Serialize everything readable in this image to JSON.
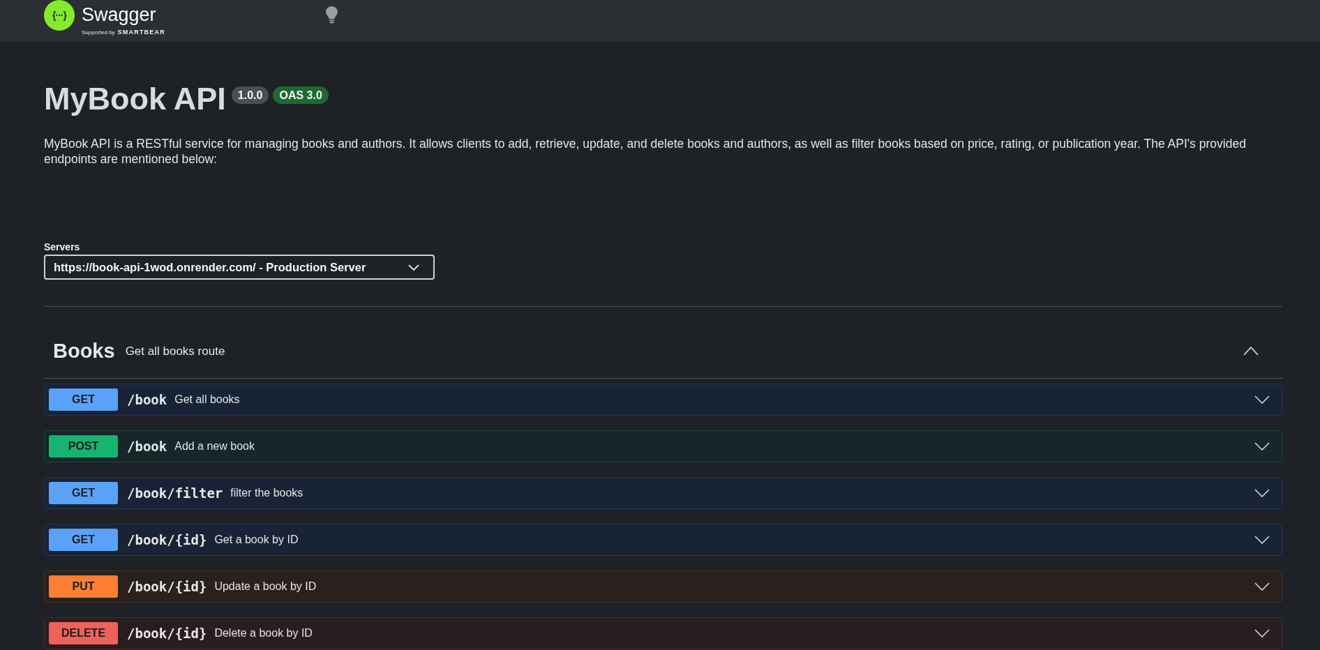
{
  "header": {
    "logo_mark": "{···}",
    "logo_text": "Swagger",
    "tagline_prefix": "Supported by",
    "tagline_brand": "SMARTBEAR"
  },
  "info": {
    "title": "MyBook API",
    "version": "1.0.0",
    "spec_version": "OAS 3.0",
    "description": "MyBook API is a RESTful service for managing books and authors. It allows clients to add, retrieve, update, and delete books and authors, as well as filter books based on price, rating, or publication year. The API's provided endpoints are mentioned below:"
  },
  "servers": {
    "label": "Servers",
    "value": "https://book-api-1wod.onrender.com/ - Production Server"
  },
  "tags": [
    {
      "name": "Books",
      "description": "Get all books route",
      "expanded": true,
      "operations": [
        {
          "kind": "get",
          "method": "GET",
          "path": "/book",
          "summary": "Get all books",
          "expanded": false
        },
        {
          "kind": "post",
          "method": "POST",
          "path": "/book",
          "summary": "Add a new book",
          "expanded": false
        },
        {
          "kind": "get",
          "method": "GET",
          "path": "/book/filter",
          "summary": "filter the books",
          "expanded": false
        },
        {
          "kind": "get",
          "method": "GET",
          "path": "/book/{id}",
          "summary": "Get a book by ID",
          "expanded": false
        },
        {
          "kind": "put",
          "method": "PUT",
          "path": "/book/{id}",
          "summary": "Update a book by ID",
          "expanded": false
        },
        {
          "kind": "delete",
          "method": "DELETE",
          "path": "/book/{id}",
          "summary": "Delete a book by ID",
          "expanded": false
        }
      ]
    }
  ]
}
